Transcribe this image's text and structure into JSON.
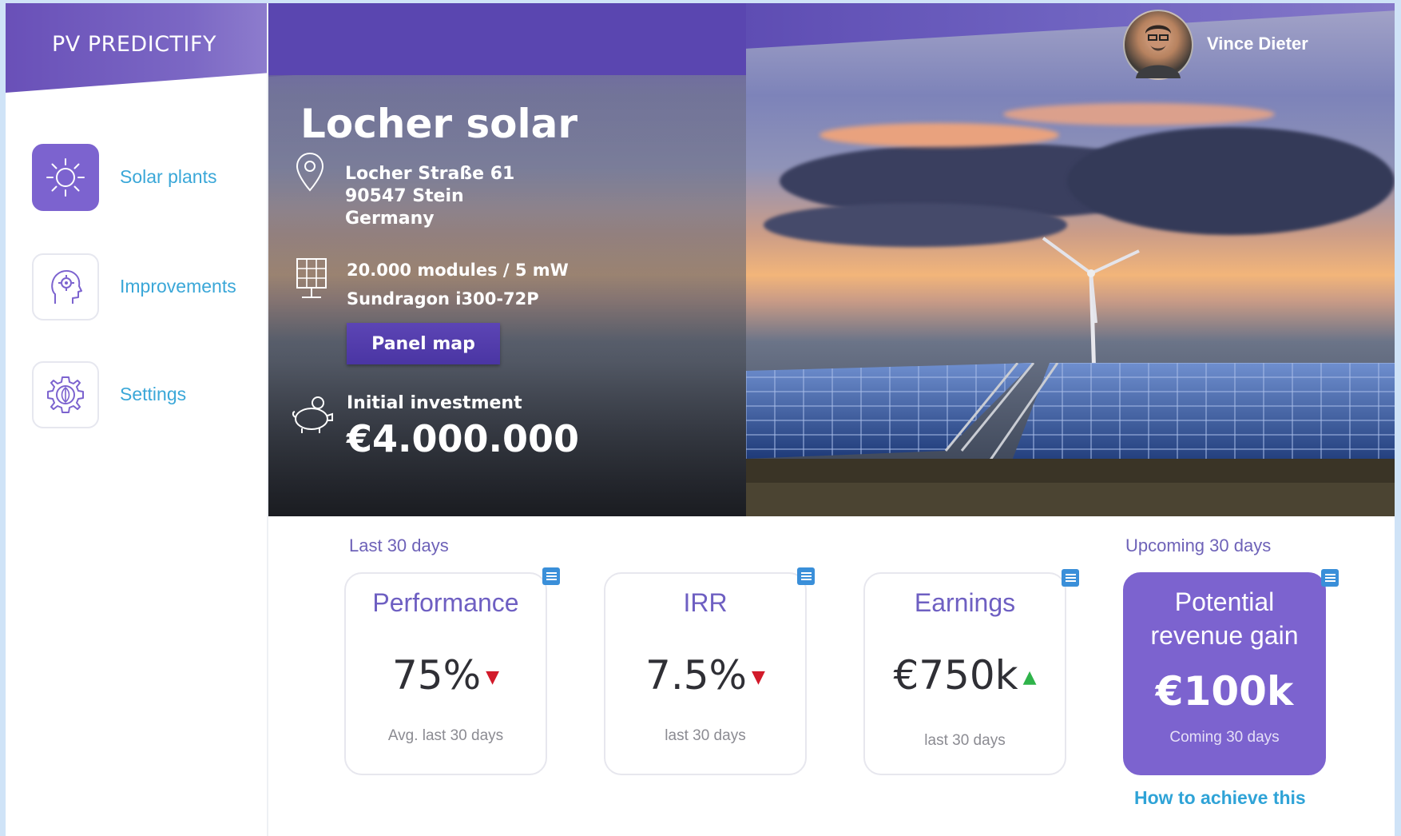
{
  "app": {
    "brand": "PV PREDICTIFY"
  },
  "user": {
    "name": "Vince Dieter"
  },
  "sidebar": {
    "items": [
      {
        "label": "Solar plants",
        "icon": "sun-icon",
        "active": true
      },
      {
        "label": "Improvements",
        "icon": "head-gear-icon",
        "active": false
      },
      {
        "label": "Settings",
        "icon": "gear-leaf-icon",
        "active": false
      }
    ]
  },
  "plant": {
    "name": "Locher solar",
    "address": [
      "Locher Straße 61",
      "90547 Stein",
      "Germany"
    ],
    "modules_line": "20.000 modules / 5 mW",
    "model": "Sundragon i300-72P",
    "panel_map_label": "Panel map",
    "investment_label": "Initial investment",
    "investment_value": "€4.000.000"
  },
  "stats": {
    "last_label": "Last 30 days",
    "upcoming_label": "Upcoming 30 days",
    "cards": [
      {
        "title": "Performance",
        "value": "75%",
        "trend": "down",
        "sub": "Avg. last 30 days"
      },
      {
        "title": "IRR",
        "value": "7.5%",
        "trend": "down",
        "sub": "last 30 days"
      },
      {
        "title": "Earnings",
        "value": "€750k",
        "trend": "up",
        "sub": "last 30 days"
      }
    ],
    "potential": {
      "title_line1": "Potential",
      "title_line2": "revenue gain",
      "value": "€100k",
      "sub": "Coming 30 days"
    },
    "how_link": "How to achieve this"
  },
  "colors": {
    "accent": "#7c63cf",
    "link": "#3aa7d8",
    "trend_down": "#d21a2a",
    "trend_up": "#2fb34a"
  }
}
